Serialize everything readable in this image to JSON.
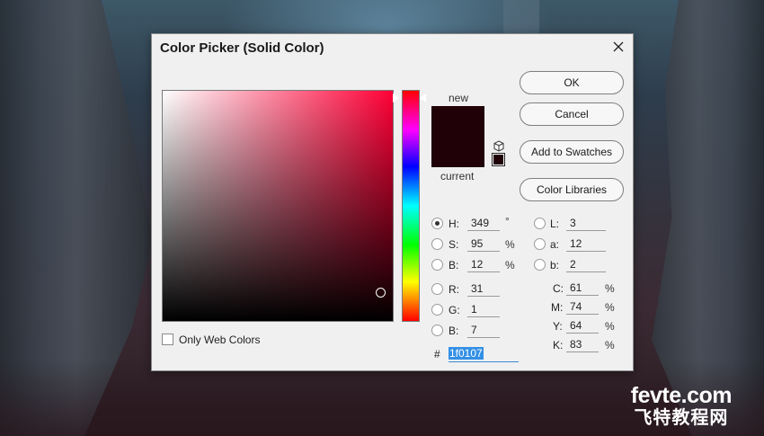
{
  "dialog": {
    "title": "Color Picker (Solid Color)",
    "new_label": "new",
    "current_label": "current",
    "new_color": "#1f0107",
    "current_color": "#1f0107"
  },
  "buttons": {
    "ok": "OK",
    "cancel": "Cancel",
    "add_swatches": "Add to Swatches",
    "color_libraries": "Color Libraries"
  },
  "only_web_colors": {
    "label": "Only Web Colors",
    "checked": false
  },
  "hsb": {
    "h": {
      "label": "H:",
      "value": "349",
      "unit": "°"
    },
    "s": {
      "label": "S:",
      "value": "95",
      "unit": "%"
    },
    "b": {
      "label": "B:",
      "value": "12",
      "unit": "%"
    }
  },
  "rgb": {
    "r": {
      "label": "R:",
      "value": "31"
    },
    "g": {
      "label": "G:",
      "value": "1"
    },
    "b": {
      "label": "B:",
      "value": "7"
    }
  },
  "lab": {
    "l": {
      "label": "L:",
      "value": "3"
    },
    "a": {
      "label": "a:",
      "value": "12"
    },
    "b": {
      "label": "b:",
      "value": "2"
    }
  },
  "cmyk": {
    "c": {
      "label": "C:",
      "value": "61",
      "unit": "%"
    },
    "m": {
      "label": "M:",
      "value": "74",
      "unit": "%"
    },
    "y": {
      "label": "Y:",
      "value": "64",
      "unit": "%"
    },
    "k": {
      "label": "K:",
      "value": "83",
      "unit": "%"
    }
  },
  "hex": {
    "label": "#",
    "value": "1f0107"
  },
  "selected_mode": "H",
  "watermark": {
    "logo": "fevte.com",
    "sub": "飞特教程网"
  }
}
